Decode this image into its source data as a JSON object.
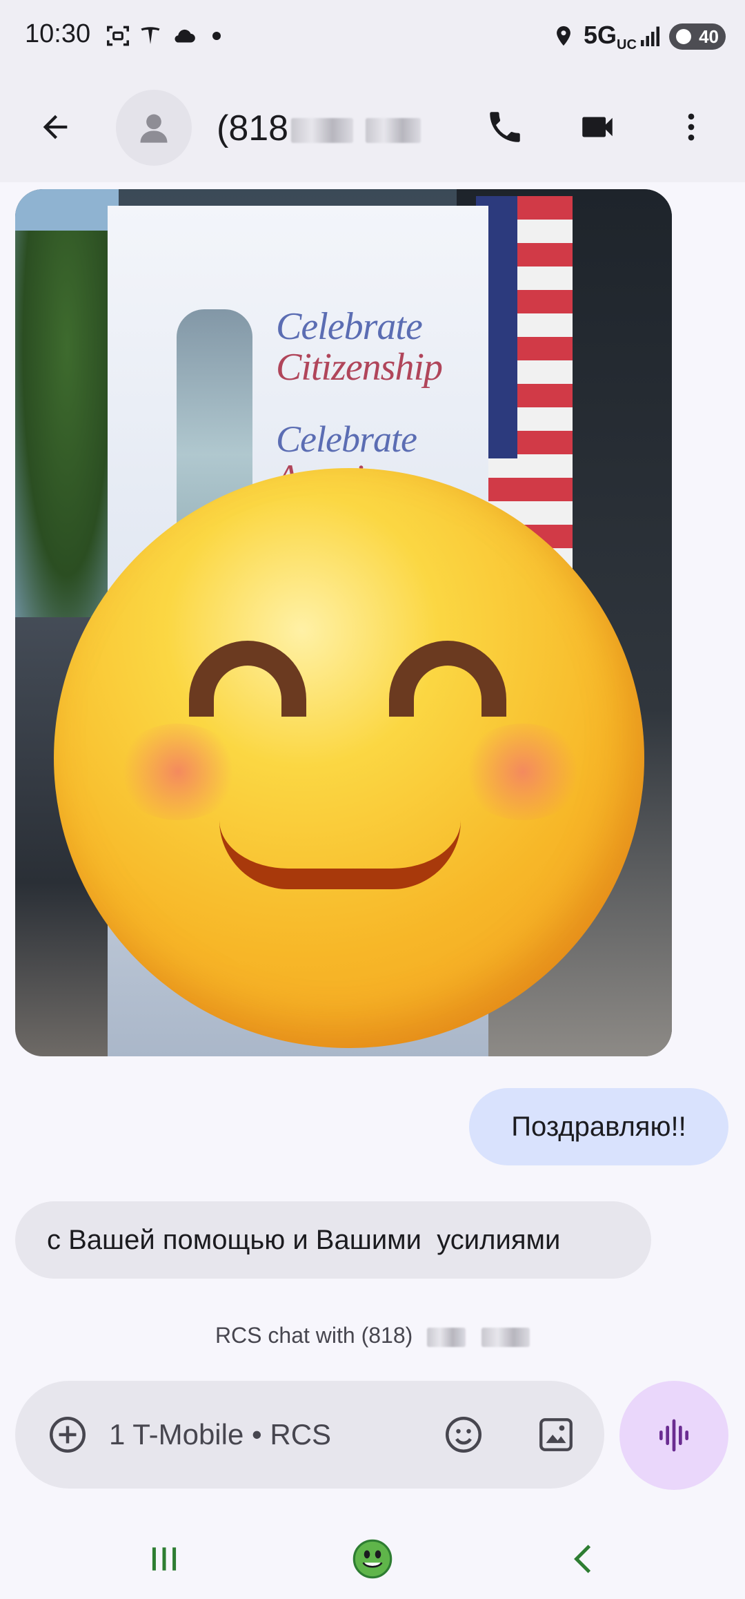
{
  "status_bar": {
    "time": "10:30",
    "network": "5G",
    "network_sub": "UC",
    "battery": "40",
    "icons": [
      "screenshot-icon",
      "tesla-icon",
      "cloud-icon",
      "notification-dot-icon",
      "location-icon",
      "signal-icon",
      "battery-icon"
    ]
  },
  "app_bar": {
    "contact_name_prefix": "(818",
    "icons": [
      "back-arrow-icon",
      "avatar-person-icon",
      "phone-icon",
      "video-camera-icon",
      "more-vert-icon"
    ]
  },
  "photo_message": {
    "banner_line1": "Celebrate",
    "banner_line2": "Citizenship",
    "banner_line3": "Celebrate",
    "banner_line4": "America"
  },
  "messages": [
    {
      "direction": "outgoing",
      "text": "Поздравляю!!"
    },
    {
      "direction": "incoming",
      "text": "с Вашей помощью и Вашими  усилиями"
    }
  ],
  "rcs_info": {
    "prefix": "RCS chat with (818)"
  },
  "compose": {
    "placeholder": "1 T-Mobile • RCS",
    "icons": [
      "add-circle-icon",
      "emoji-icon",
      "gallery-icon",
      "voice-waveform-icon"
    ]
  },
  "nav_bar": {
    "icons": [
      "recents-icon",
      "home-icon",
      "back-chevron-icon"
    ]
  },
  "colors": {
    "outgoing_bubble": "#d9e2fd",
    "incoming_bubble": "#e7e6ed",
    "voice_button": "#ead7fb",
    "voice_icon": "#6a2c91",
    "nav_green": "#2e7d32"
  }
}
